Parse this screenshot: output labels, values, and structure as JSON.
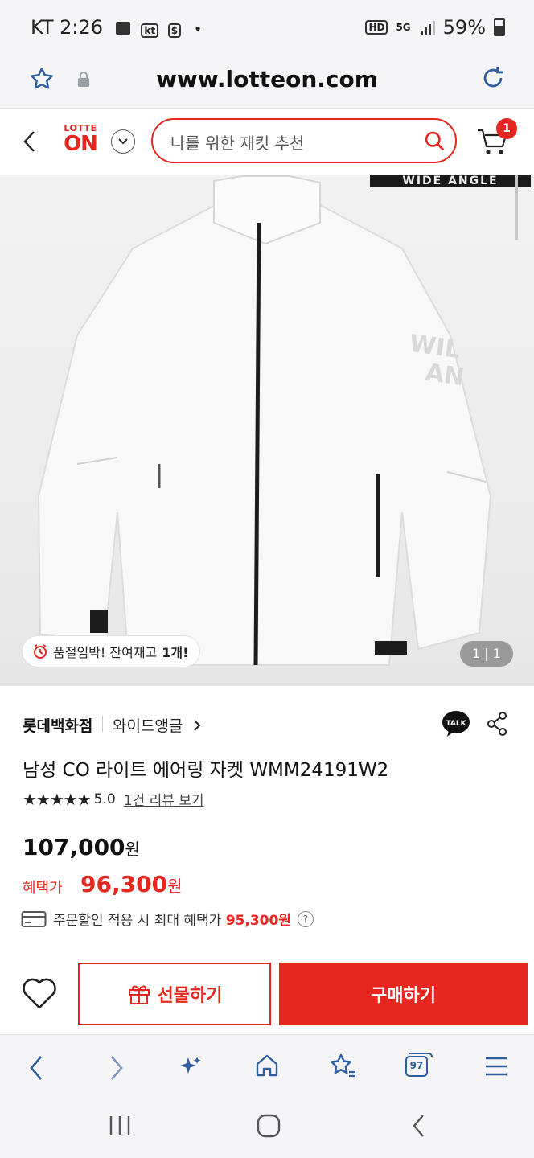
{
  "status_bar": {
    "time": "KT 2:26",
    "dot": "•",
    "hd": "HD",
    "network": "5G",
    "battery": "59%"
  },
  "browser": {
    "url": "www.lotteon.com",
    "tab_count": "97"
  },
  "site_header": {
    "logo_top": "LOTTE",
    "logo_bottom": "ON",
    "search_placeholder": "나를 위한 재킷 추천",
    "cart_count": "1"
  },
  "hero": {
    "brand_strip": "WIDE ANGLE",
    "stock_prefix": "품절임박! 잔여재고 ",
    "stock_count": "1개!",
    "page_indicator": "1 | 1"
  },
  "product": {
    "store": "롯데백화점",
    "brand": "와이드앵글",
    "title": "남성 CO 라이트 에어링 자켓 WMM24191W2",
    "rating": "5.0",
    "review_link": "1건 리뷰 보기",
    "price": "107,000",
    "price_unit": "원",
    "benefit_label": "혜택가",
    "benefit_price": "96,300",
    "benefit_unit": "원",
    "coupon_text": "주문할인 적용 시 최대 혜택가 ",
    "coupon_price": "95,300원",
    "help": "?"
  },
  "actions": {
    "gift": "선물하기",
    "buy": "구매하기"
  },
  "colors": {
    "accent": "#e5271f",
    "browser_blue": "#2f5e9e"
  }
}
